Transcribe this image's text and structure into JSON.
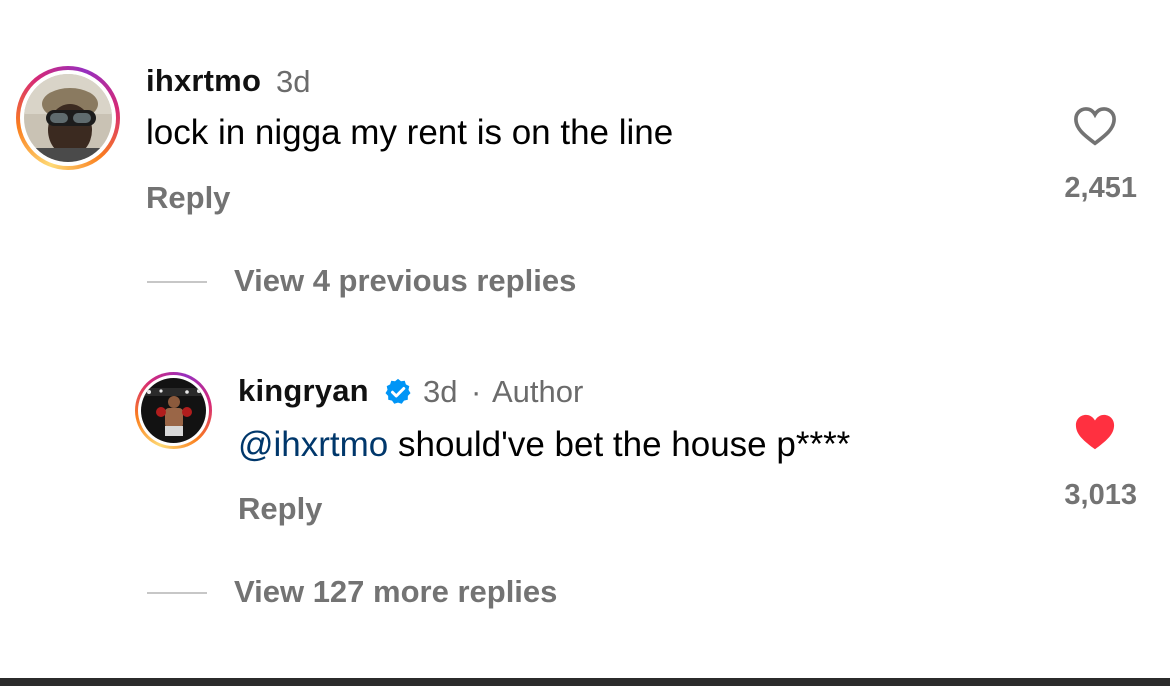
{
  "comment": {
    "username": "ihxrtmo",
    "time": "3d",
    "text": "lock in nigga my rent is on the line",
    "reply_label": "Reply",
    "like_count": "2,451",
    "liked": false,
    "avatar_icon": "user-avatar-goggles"
  },
  "view_previous": "View 4 previous replies",
  "reply": {
    "username": "kingryan",
    "time": "3d",
    "separator": "·",
    "author_label": "Author",
    "mention": "@ihxrtmo",
    "text": " should've bet the house p****",
    "reply_label": "Reply",
    "like_count": "3,013",
    "liked": true,
    "verified_icon": "verified-badge-icon",
    "avatar_icon": "user-avatar-boxer"
  },
  "view_more": "View 127 more replies",
  "colors": {
    "heart_liked": "#ff3040",
    "mention": "#00376b",
    "verified": "#0095f6",
    "secondary_text": "#737373"
  }
}
